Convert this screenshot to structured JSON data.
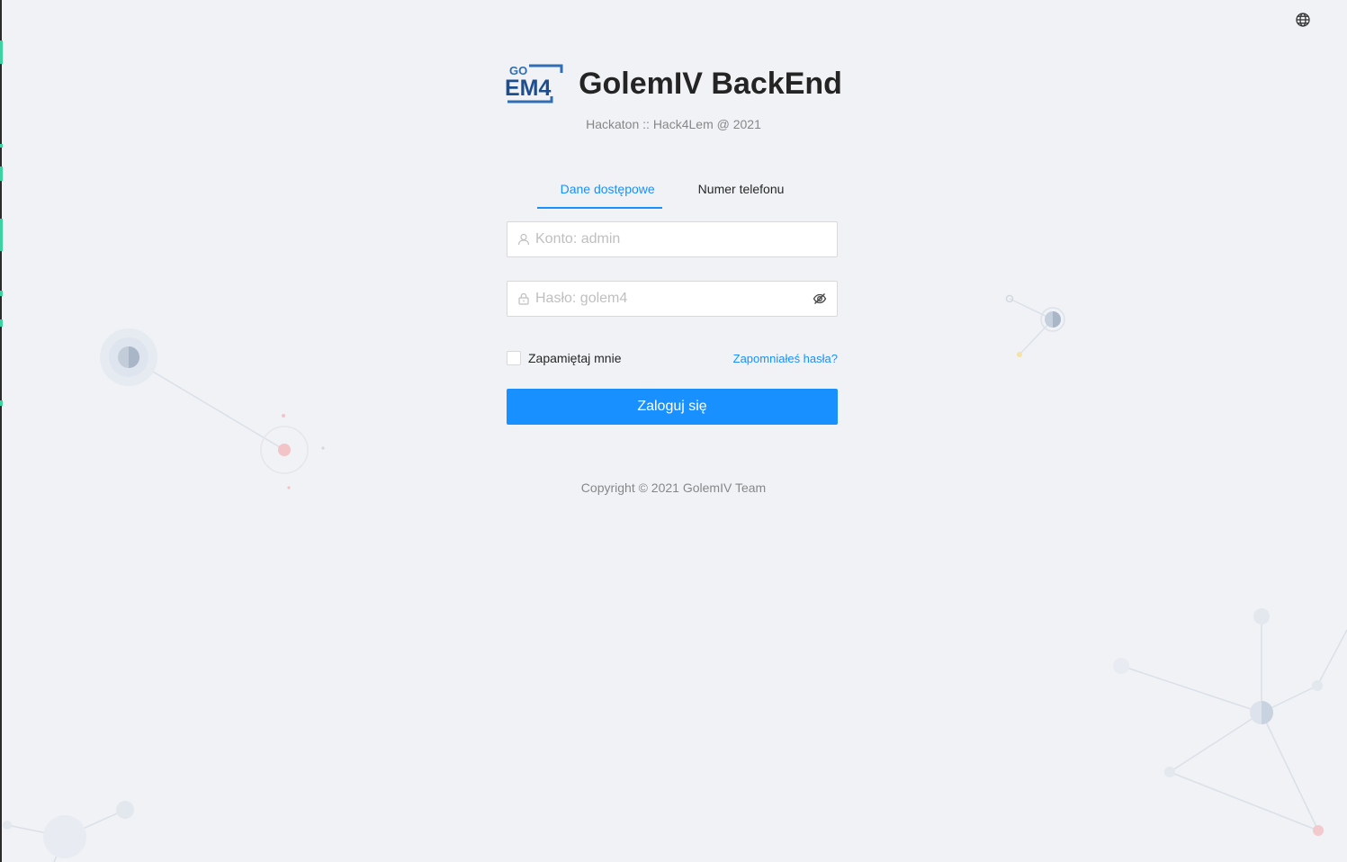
{
  "header": {
    "logo_top": "GO",
    "logo_bottom": "EM4",
    "title": "GolemIV BackEnd",
    "subtitle": "Hackaton :: Hack4Lem @ 2021"
  },
  "tabs": [
    {
      "label": "Dane dostępowe",
      "active": true
    },
    {
      "label": "Numer telefonu",
      "active": false
    }
  ],
  "form": {
    "username": {
      "value": "",
      "placeholder": "Konto: admin",
      "icon": "user-icon"
    },
    "password": {
      "value": "",
      "placeholder": "Hasło: golem4",
      "icon": "lock-icon",
      "toggle_icon": "eye-invisible-icon"
    },
    "remember_label": "Zapamiętaj mnie",
    "remember_checked": false,
    "forgot_label": "Zapomniałeś hasła?",
    "submit_label": "Zaloguj się"
  },
  "footer": {
    "copyright": "Copyright © 2021 GolemIV Team"
  },
  "language_icon": "globe-icon",
  "colors": {
    "accent": "#1890ff",
    "background": "#f0f2f5",
    "logo_blue": "#2f6db5"
  }
}
